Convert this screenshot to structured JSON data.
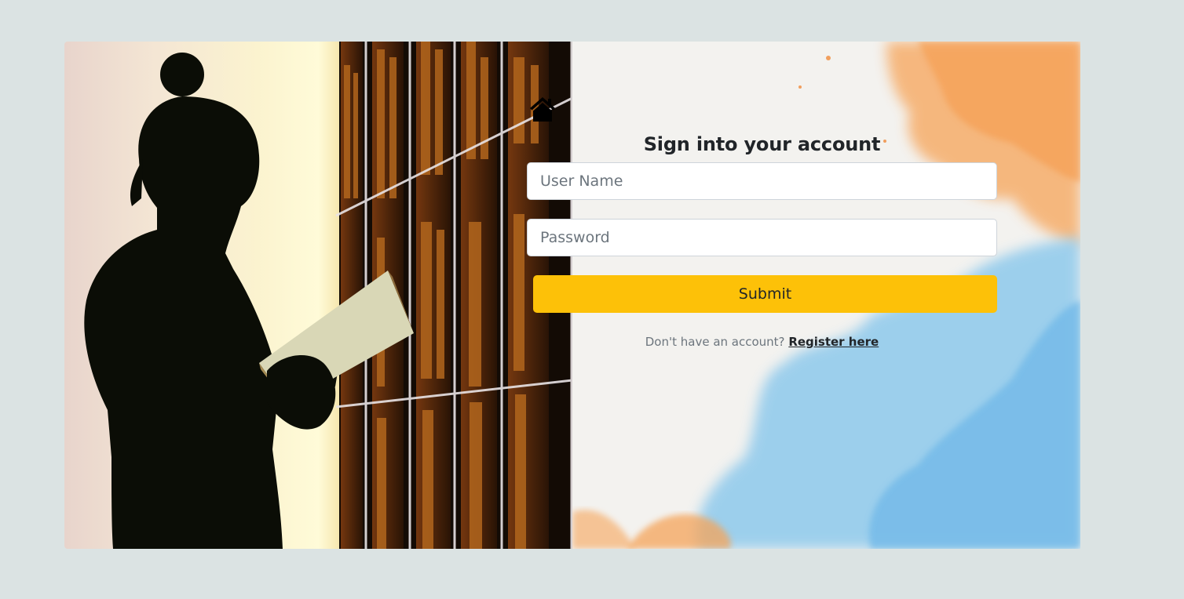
{
  "page": {
    "background_color": "#dbe3e3"
  },
  "hero": {
    "image": "girl-reading-book-silhouette-library"
  },
  "form": {
    "home_icon": "home-icon",
    "title": "Sign into your account",
    "username": {
      "placeholder": "User Name",
      "value": ""
    },
    "password": {
      "placeholder": "Password",
      "value": ""
    },
    "submit_label": "Submit",
    "submit_color": "#fdc108",
    "register_prompt": "Don't have an account?",
    "register_link": "Register here"
  }
}
